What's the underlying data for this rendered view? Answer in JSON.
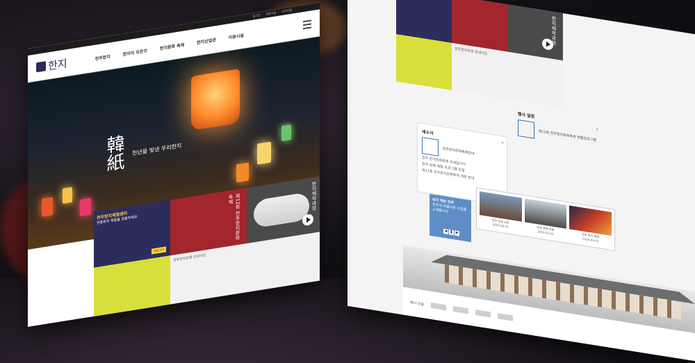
{
  "brand": {
    "name": "한지"
  },
  "topbar": {
    "links": [
      "로그인",
      "회원가입",
      "사이트맵"
    ]
  },
  "nav": {
    "items": [
      "전주한지",
      "한지의 모든것",
      "한지문화 축제",
      "한지산업관",
      "이용시설"
    ]
  },
  "hero": {
    "title": "韓紙",
    "subtitle": "천년을 빛낸 우리한지"
  },
  "tiles": {
    "center": {
      "title": "전주한지체험센터",
      "desc": "전통한지 체험을 경험하세요",
      "button": "바로가기"
    },
    "poster": {
      "title": "제12회 전주한지문화축제"
    },
    "gallery": {
      "title": "한지제작과정"
    },
    "map": {
      "title": "전주한지관광 안내지도"
    }
  },
  "notice": {
    "title": "새소식",
    "headline": "전주한지문화축제안내",
    "lines": [
      "전주 한지문화축제 안내입니다",
      "한지 공예 체험 프로그램 모집",
      "제12회 전주한지문화축제 개최 안내"
    ]
  },
  "events": {
    "title": "행사 일정",
    "headline": "제12회 전주한지문화축제 체험프로그램"
  },
  "photo_card": {
    "title": "내가 찍은 전주",
    "desc": "전주의 아름다운 사진을 소개합니다"
  },
  "gallery": [
    {
      "caption": "전주 전동 성당",
      "date": "2015-03-01"
    },
    {
      "caption": "전주 한옥 마을",
      "date": "2015-03-01"
    },
    {
      "caption": "전주 한지 축제",
      "date": "2015-03-01"
    }
  ],
  "footer": {
    "label": "배너 모음"
  }
}
